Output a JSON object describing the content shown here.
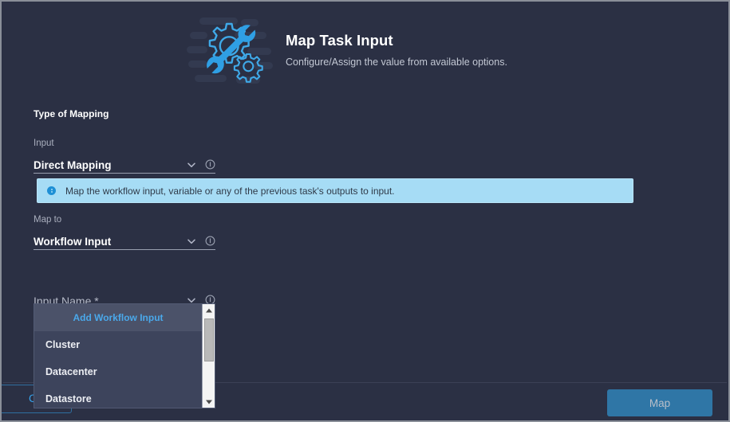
{
  "header": {
    "icon": "gears-wrench-icon",
    "title": "Map Task Input",
    "subtitle": "Configure/Assign the value from available options."
  },
  "form": {
    "section_title": "Type of Mapping",
    "fields": [
      {
        "label": "Input",
        "value": "Direct Mapping",
        "chevron_icon": "chevron-down-icon",
        "info_icon": "info-circle-icon"
      },
      {
        "label": "Map to",
        "value": "Workflow Input",
        "chevron_icon": "chevron-down-icon",
        "info_icon": "info-circle-icon"
      },
      {
        "label": "",
        "value": "Input Name *",
        "chevron_icon": "chevron-down-icon",
        "info_icon": "info-circle-icon"
      }
    ]
  },
  "banner": {
    "icon": "info-circle-icon",
    "text": "Map the workflow input, variable or any of the previous task's outputs to input.",
    "background_color": "#a6dcf5",
    "text_color": "#2f3a48"
  },
  "dropdown": {
    "header_item": "Add Workflow Input",
    "header_color": "#4aa8ea",
    "items": [
      "Cluster",
      "Datacenter",
      "Datastore"
    ],
    "scrollbar": {
      "up_arrow_icon": "triangle-up-icon",
      "down_arrow_icon": "triangle-down-icon"
    }
  },
  "footer": {
    "cancel_label": "Cancel",
    "map_label": "Map",
    "map_button_color": "#2f76a6",
    "cancel_text_color": "#36a4ee"
  },
  "theme": {
    "background": "#2b3044",
    "accent": "#1ba0e1",
    "panel": "#3d445c"
  }
}
